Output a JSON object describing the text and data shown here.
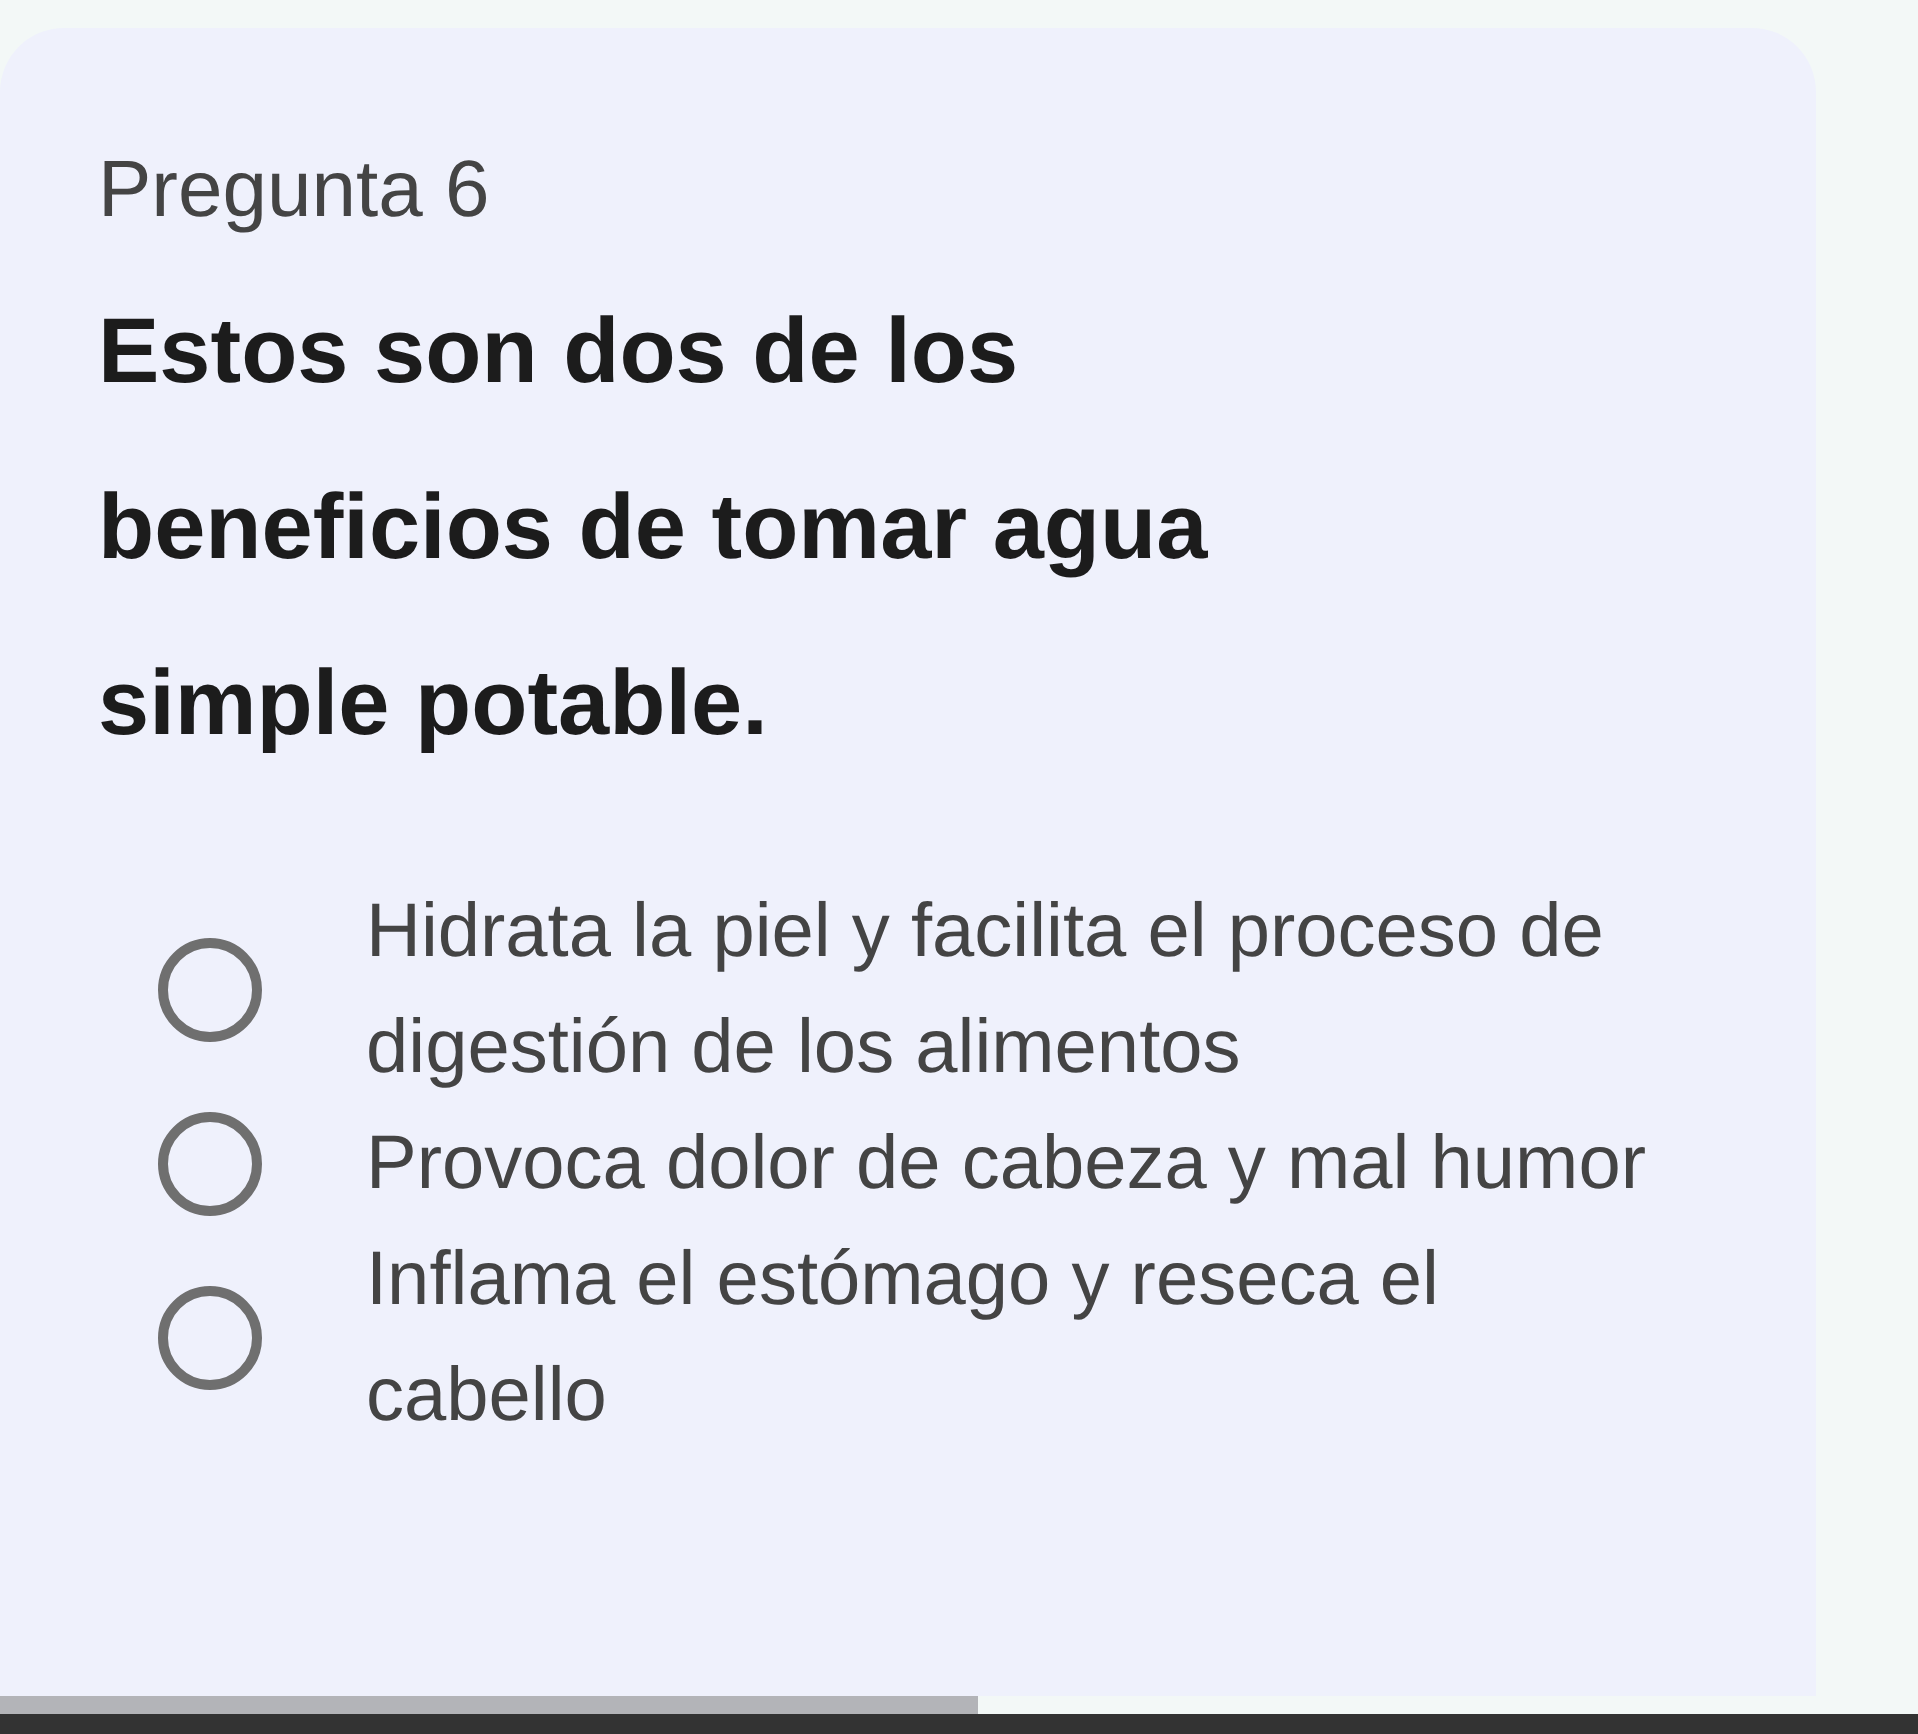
{
  "question": {
    "label": "Pregunta 6",
    "text": "Estos son dos de los beneficios de tomar agua simple potable."
  },
  "options": [
    {
      "text": "Hidrata la piel y facilita el proceso de digestión de los alimentos",
      "selected": false
    },
    {
      "text": "Provoca dolor de cabeza y mal humor",
      "selected": false
    },
    {
      "text": "Inflama el estómago y reseca el cabello",
      "selected": false
    }
  ],
  "progress": {
    "level": 0.51
  }
}
